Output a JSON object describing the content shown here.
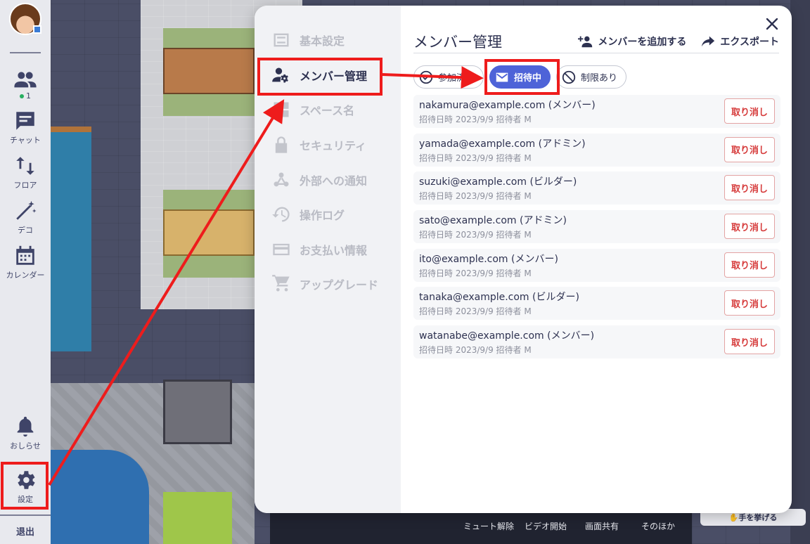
{
  "appbar": {
    "online_count": "1",
    "chat_label": "チャット",
    "floor_label": "フロア",
    "deco_label": "デコ",
    "calendar_label": "カレンダー",
    "notice_label": "おしらせ",
    "settings_label": "設定",
    "logout_label": "退出"
  },
  "modal": {
    "sidebar": [
      {
        "label": "基本設定",
        "icon": "toggles-icon"
      },
      {
        "label": "メンバー管理",
        "icon": "member-settings-icon"
      },
      {
        "label": "スペース名",
        "icon": "grid-icon"
      },
      {
        "label": "セキュリティ",
        "icon": "lock-icon"
      },
      {
        "label": "外部への通知",
        "icon": "webhook-icon"
      },
      {
        "label": "操作ログ",
        "icon": "history-icon"
      },
      {
        "label": "お支払い情報",
        "icon": "credit-card-icon"
      },
      {
        "label": "アップグレード",
        "icon": "cart-icon"
      }
    ],
    "active_item": "メンバー管理",
    "title": "メンバー管理",
    "add_member_label": "メンバーを追加する",
    "export_label": "エクスポート",
    "tabs": [
      {
        "label": "参加済み",
        "icon": "check-circle-icon"
      },
      {
        "label": "招待中",
        "icon": "mail-icon"
      },
      {
        "label": "制限あり",
        "icon": "block-icon"
      }
    ],
    "selected_tab": "招待中",
    "revoke_label": "取り消し",
    "invites": [
      {
        "email": "nakamura@example.com (メンバー)",
        "meta": "招待日時 2023/9/9 招待者 M"
      },
      {
        "email": "yamada@example.com (アドミン)",
        "meta": "招待日時 2023/9/9 招待者 M"
      },
      {
        "email": "suzuki@example.com (ビルダー)",
        "meta": "招待日時 2023/9/9 招待者 M"
      },
      {
        "email": "sato@example.com (アドミン)",
        "meta": "招待日時 2023/9/9 招待者 M"
      },
      {
        "email": "ito@example.com (メンバー)",
        "meta": "招待日時 2023/9/9 招待者 M"
      },
      {
        "email": "tanaka@example.com (ビルダー)",
        "meta": "招待日時 2023/9/9 招待者 M"
      },
      {
        "email": "watanabe@example.com (メンバー)",
        "meta": "招待日時 2023/9/9 招待者 M"
      }
    ]
  },
  "toolbar": {
    "unmute": "ミュート解除",
    "video": "ビデオ開始",
    "share": "画面共有",
    "more": "そのほか",
    "hand": "手を挙げる"
  },
  "colors": {
    "accent": "#4e63d8",
    "annotation": "#ee1c1c",
    "danger": "#d63b3b"
  }
}
